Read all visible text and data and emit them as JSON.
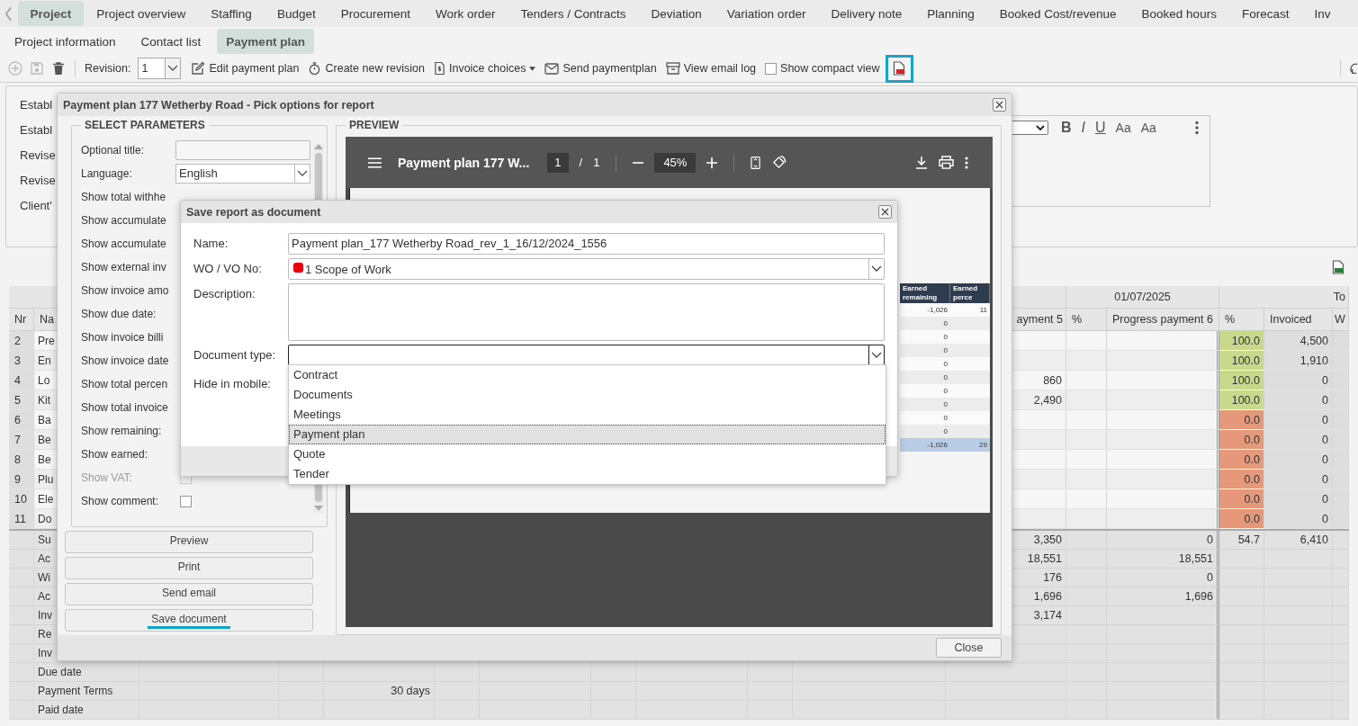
{
  "nav": {
    "tabs": [
      {
        "label": "Project",
        "selected": true
      },
      {
        "label": "Project overview",
        "selected": false
      },
      {
        "label": "Staffing",
        "selected": false
      },
      {
        "label": "Budget",
        "selected": false
      },
      {
        "label": "Procurement",
        "selected": false
      },
      {
        "label": "Work order",
        "selected": false
      },
      {
        "label": "Tenders / Contracts",
        "selected": false
      },
      {
        "label": "Deviation",
        "selected": false
      },
      {
        "label": "Variation order",
        "selected": false
      },
      {
        "label": "Delivery note",
        "selected": false
      },
      {
        "label": "Planning",
        "selected": false
      },
      {
        "label": "Booked Cost/revenue",
        "selected": false
      },
      {
        "label": "Booked hours",
        "selected": false
      },
      {
        "label": "Forecast",
        "selected": false
      },
      {
        "label": "Inv",
        "selected": false
      }
    ]
  },
  "subtabs": [
    {
      "label": "Project information",
      "selected": false
    },
    {
      "label": "Contact list",
      "selected": false
    },
    {
      "label": "Payment plan",
      "selected": true
    }
  ],
  "toolbar": {
    "revision_label": "Revision:",
    "revision": "1",
    "actions": [
      {
        "kind": "edit",
        "label": "Edit payment plan",
        "dropdown": false
      },
      {
        "kind": "revision",
        "label": "Create new revision",
        "dropdown": false
      },
      {
        "kind": "invoice",
        "label": "Invoice choices",
        "dropdown": true
      },
      {
        "kind": "send",
        "label": "Send paymentplan",
        "dropdown": false
      },
      {
        "kind": "log",
        "label": "View email log",
        "dropdown": false
      }
    ],
    "compact_view": {
      "label": "Show compact view",
      "checked": false
    },
    "pdf_export": {
      "highlighted": true
    }
  },
  "form": {
    "labels": [
      "Establ",
      "Establ",
      "Revise",
      "Revise",
      "Client'"
    ]
  },
  "editor": {
    "buttons": [
      {
        "kind": "bold",
        "label": "B"
      },
      {
        "kind": "italic",
        "label": "I"
      },
      {
        "kind": "underline",
        "label": "U"
      },
      {
        "kind": "case",
        "label": "Aa"
      },
      {
        "kind": "case",
        "label": "Aa"
      }
    ]
  },
  "table": {
    "date_group": "01/07/2025",
    "total_group": "To",
    "columns": {
      "nr": "Nr",
      "name": "Na",
      "payment_5": "ayment 5",
      "pct_5": "%",
      "payment_6": "Progress payment 6",
      "pct": "%",
      "invoiced": "Invoiced",
      "column_last": "W"
    },
    "rows": [
      {
        "nr": "2",
        "name": "Pre",
        "pct": "100.0",
        "color": "#c9d98b",
        "invoiced": "4,500"
      },
      {
        "nr": "3",
        "name": "En",
        "pct": "100.0",
        "color": "#c9d98b",
        "invoiced": "1,910"
      },
      {
        "nr": "4",
        "name": "Lo",
        "payment_5": "860",
        "pct": "100.0",
        "color": "#c9d98b",
        "invoiced": "0"
      },
      {
        "nr": "5",
        "name": "Kit",
        "payment_5": "2,490",
        "pct": "100.0",
        "color": "#c9d98b",
        "invoiced": "0"
      },
      {
        "nr": "6",
        "name": "Ba",
        "pct": "0.0",
        "color": "#e5987a",
        "invoiced": "0"
      },
      {
        "nr": "7",
        "name": "Be",
        "pct": "0.0",
        "color": "#e5987a",
        "invoiced": "0"
      },
      {
        "nr": "8",
        "name": "Be",
        "pct": "0.0",
        "color": "#e5987a",
        "invoiced": "0"
      },
      {
        "nr": "9",
        "name": "Plu",
        "pct": "0.0",
        "color": "#e5987a",
        "invoiced": "0"
      },
      {
        "nr": "10",
        "name": "Ele",
        "pct": "0.0",
        "color": "#e5987a",
        "invoiced": "0"
      },
      {
        "nr": "11",
        "name": "Do",
        "pct": "0.0",
        "color": "#e5987a",
        "invoiced": "0"
      }
    ],
    "summary": [
      {
        "label": "Su",
        "payment_5": "3,350",
        "payment_6": "0",
        "pct": "54.7",
        "invoiced": "6,410"
      },
      {
        "label": "Ac",
        "payment_5": "18,551",
        "payment_6": "18,551"
      },
      {
        "label": "Wi",
        "payment_5": "176",
        "payment_6": "0"
      },
      {
        "label": "Ac",
        "payment_5": "1,696",
        "payment_6": "1,696"
      },
      {
        "label": "Inv",
        "payment_5": "3,174"
      },
      {
        "label": "Re"
      },
      {
        "label": "Inv"
      },
      {
        "label": "Due date"
      },
      {
        "label": "Payment Terms",
        "column_5": "30 days"
      },
      {
        "label": "Paid date"
      }
    ]
  },
  "report_dialog": {
    "title": "Payment plan 177 Wetherby Road - Pick options for report",
    "parameters_title": "SELECT PARAMETERS",
    "parameters": [
      {
        "kind": "text",
        "label": "Optional title:"
      },
      {
        "kind": "select",
        "label": "Language:",
        "value": "English"
      },
      {
        "kind": "label",
        "label": "Show total withhe"
      },
      {
        "kind": "label",
        "label": "Show accumulate"
      },
      {
        "kind": "label",
        "label": "Show accumulate"
      },
      {
        "kind": "label",
        "label": "Show external inv"
      },
      {
        "kind": "label",
        "label": "Show invoice amo"
      },
      {
        "kind": "label",
        "label": "Show due date:"
      },
      {
        "kind": "label",
        "label": "Show invoice billi"
      },
      {
        "kind": "label",
        "label": "Show invoice date"
      },
      {
        "kind": "label",
        "label": "Show total percen"
      },
      {
        "kind": "label",
        "label": "Show total invoice"
      },
      {
        "kind": "label",
        "label": "Show remaining:"
      },
      {
        "kind": "label",
        "label": "Show earned:"
      },
      {
        "kind": "checkbox",
        "label": "Show VAT:",
        "checked": false,
        "disabled": true
      },
      {
        "kind": "checkbox",
        "label": "Show comment:",
        "checked": false,
        "disabled": false
      }
    ],
    "buttons": [
      {
        "label": "Preview",
        "highlighted": false
      },
      {
        "label": "Print",
        "highlighted": false
      },
      {
        "label": "Send email",
        "highlighted": false
      },
      {
        "label": "Save document",
        "highlighted": true
      }
    ],
    "preview_title": "PREVIEW",
    "viewer": {
      "title": "Payment plan 177 W...",
      "page": "1",
      "separator": "/",
      "pages": "1",
      "zoom": "45%"
    },
    "preview_table": {
      "columns": [
        "Earned remaining",
        "Earned perce"
      ],
      "rows": [
        {
          "cells": [
            "-1,026",
            "11"
          ],
          "total": false
        },
        {
          "cells": [
            "0"
          ],
          "total": false
        },
        {
          "cells": [
            "0"
          ],
          "total": false
        },
        {
          "cells": [
            "0"
          ],
          "total": false
        },
        {
          "cells": [
            "0"
          ],
          "total": false
        },
        {
          "cells": [
            "0"
          ],
          "total": false
        },
        {
          "cells": [
            "0"
          ],
          "total": false
        },
        {
          "cells": [
            "0"
          ],
          "total": false
        },
        {
          "cells": [
            "0"
          ],
          "total": false
        },
        {
          "cells": [
            "0"
          ],
          "total": false
        },
        {
          "cells": [
            "-1,026",
            "29"
          ],
          "total": true
        }
      ]
    },
    "close": "Close"
  },
  "save_dialog": {
    "title": "Save report as document",
    "fields": [
      {
        "kind": "text",
        "label": "Name:",
        "value": "Payment plan_177 Wetherby Road_rev_1_16/12/2024_1556"
      },
      {
        "kind": "select",
        "label": "WO / VO No:",
        "value": "1 Scope of Work",
        "color": "#e8000b",
        "focused": false
      },
      {
        "kind": "textarea",
        "label": "Description:"
      },
      {
        "kind": "select",
        "label": "Document type:",
        "focused": true
      },
      {
        "kind": "label",
        "label": "Hide in mobile:"
      }
    ],
    "options": [
      {
        "label": "Contract",
        "selected": false
      },
      {
        "label": "Documents",
        "selected": false
      },
      {
        "label": "Meetings",
        "selected": false
      },
      {
        "label": "Payment plan",
        "selected": true
      },
      {
        "label": "Quote",
        "selected": false
      },
      {
        "label": "Tender",
        "selected": false
      }
    ]
  }
}
